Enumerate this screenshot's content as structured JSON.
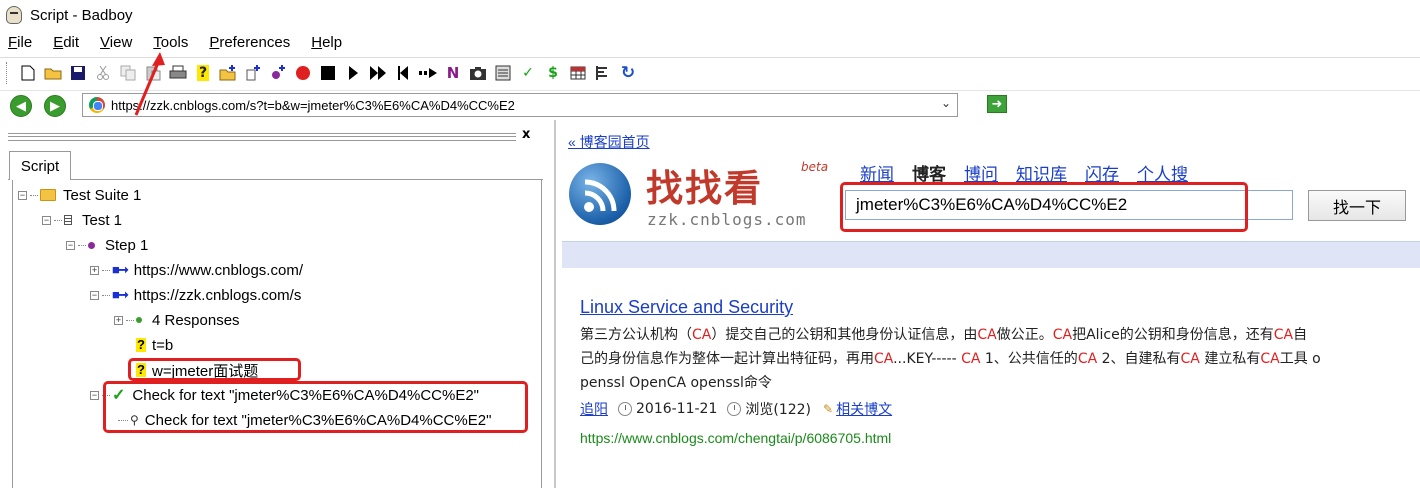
{
  "window": {
    "title": "Script - Badboy"
  },
  "menu": [
    {
      "label": "File",
      "key": "F",
      "rest": "ile"
    },
    {
      "label": "Edit",
      "key": "E",
      "rest": "dit"
    },
    {
      "label": "View",
      "key": "V",
      "rest": "iew"
    },
    {
      "label": "Tools",
      "key": "T",
      "rest": "ools"
    },
    {
      "label": "Preferences",
      "key": "P",
      "rest": "references"
    },
    {
      "label": "Help",
      "key": "H",
      "rest": "elp"
    }
  ],
  "toolbar_icons": [
    "new-icon",
    "open-icon",
    "save-icon",
    "cut-icon",
    "copy-icon",
    "paste-icon",
    "print-icon",
    "help-icon",
    "add-suite-icon",
    "add-test-icon",
    "add-step-icon",
    "record-icon",
    "stop-icon",
    "play-icon",
    "fast-forward-icon",
    "rewind-icon",
    "step-icon",
    "n-icon",
    "snapshot-icon",
    "report-icon",
    "check-icon",
    "variable-icon",
    "table-icon",
    "format-icon",
    "refresh-icon"
  ],
  "address": {
    "url": "https://zzk.cnblogs.com/s?t=b&w=jmeter%C3%E6%CA%D4%CC%E2"
  },
  "left_panel": {
    "tab": "Script",
    "close": "x",
    "tree": {
      "suite": "Test Suite 1",
      "test": "Test 1",
      "step": "Step 1",
      "request1": "https://www.cnblogs.com/",
      "request2": "https://zzk.cnblogs.com/s",
      "responses": "4 Responses",
      "param1": "t=b",
      "param2": "w=jmeter面试题",
      "check1": "Check for text \"jmeter%C3%E6%CA%D4%CC%E2\"",
      "check2": "Check for text \"jmeter%C3%E6%CA%D4%CC%E2\""
    }
  },
  "page": {
    "home_link": "« 博客园首页",
    "logo_text": "找找看",
    "beta": "beta",
    "logo_sub": "zzk.cnblogs.com",
    "nav": [
      "新闻",
      "博客",
      "博问",
      "知识库",
      "闪存",
      "个人搜"
    ],
    "nav_current": "博客",
    "search_value": "jmeter%C3%E6%CA%D4%CC%E2",
    "search_button": "找一下",
    "result": {
      "title": "Linux Service and Security",
      "snippet_line1": [
        "第三方公认机构（",
        "CA",
        "）提交自己的公钥和其他身份认证信息，由",
        "CA",
        "做公正。",
        "CA",
        "把Alice的公钥和身份信息，还有",
        "CA",
        "自"
      ],
      "snippet_line2": [
        "己的身份信息作为整体一起计算出特征码，再用",
        "CA",
        "...KEY----- ",
        "CA",
        " 1、公共信任的",
        "CA",
        " 2、自建私有",
        "CA",
        " 建立私有",
        "CA",
        "工具 o"
      ],
      "snippet_line3": "penssl OpenCA openssl命令",
      "author": "追阳",
      "date": "2016-11-21",
      "views": "浏览(122)",
      "related": "相关博文",
      "url": "https://www.cnblogs.com/chengtai/p/6086705.html"
    }
  },
  "colors": {
    "highlight": "#e02020",
    "link": "#1a3ec8",
    "url_green": "#1a8a1a",
    "band": "#dfe4f7"
  }
}
